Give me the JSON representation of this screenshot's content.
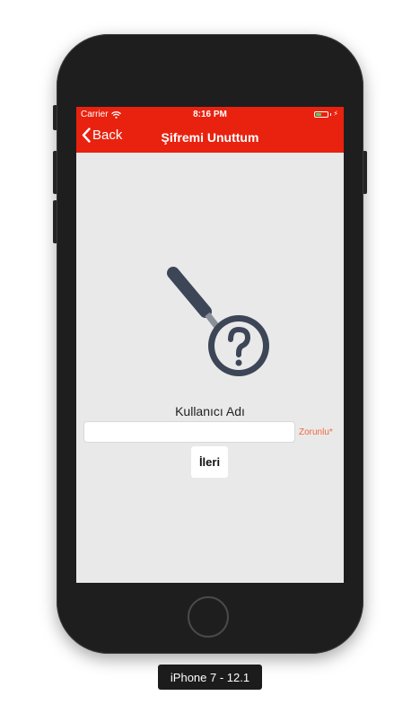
{
  "device_caption": "iPhone 7 - 12.1",
  "status_bar": {
    "carrier": "Carrier",
    "time": "8:16 PM",
    "battery_level": 0.5,
    "battery_color": "#4cd964"
  },
  "nav_bar": {
    "back_label": "Back",
    "title": "Şifremi Unuttum",
    "background_color": "#e8220f"
  },
  "form": {
    "username_label": "Kullanıcı Adı",
    "username_value": "",
    "required_note": "Zorunlu*",
    "next_button_label": "İleri"
  },
  "icons": {
    "illustration": "magnifier-question-icon",
    "back": "chevron-left-icon",
    "wifi": "wifi-icon",
    "battery": "battery-icon",
    "charging": "bolt-icon"
  }
}
